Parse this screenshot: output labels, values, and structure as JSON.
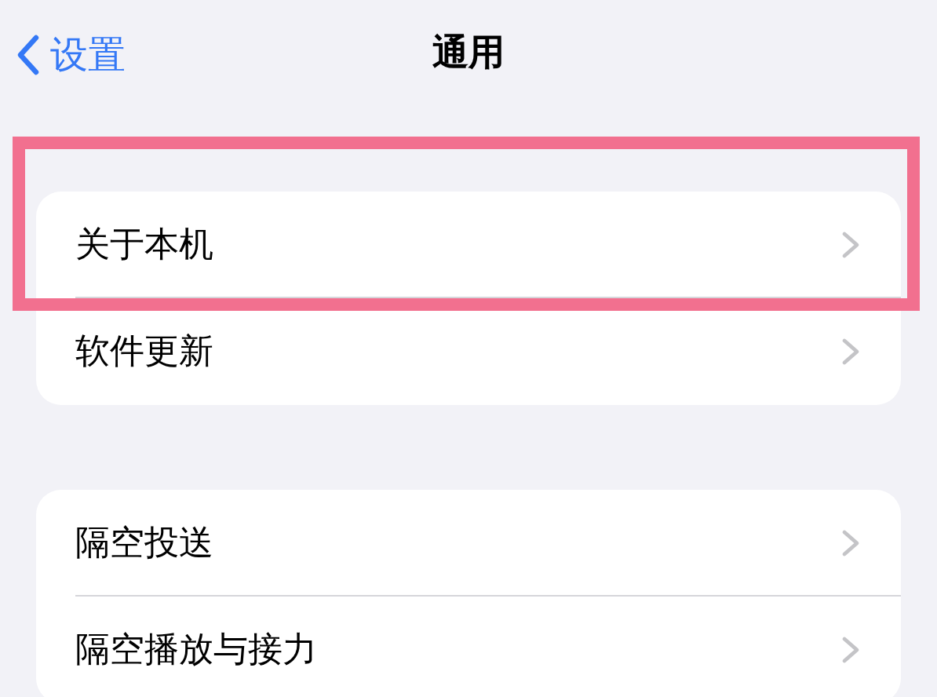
{
  "nav": {
    "back_label": "设置",
    "title": "通用"
  },
  "groups": [
    {
      "rows": [
        {
          "label": "关于本机",
          "highlighted": true
        },
        {
          "label": "软件更新",
          "highlighted": false
        }
      ]
    },
    {
      "rows": [
        {
          "label": "隔空投送",
          "highlighted": false
        },
        {
          "label": "隔空播放与接力",
          "highlighted": false
        }
      ]
    }
  ]
}
